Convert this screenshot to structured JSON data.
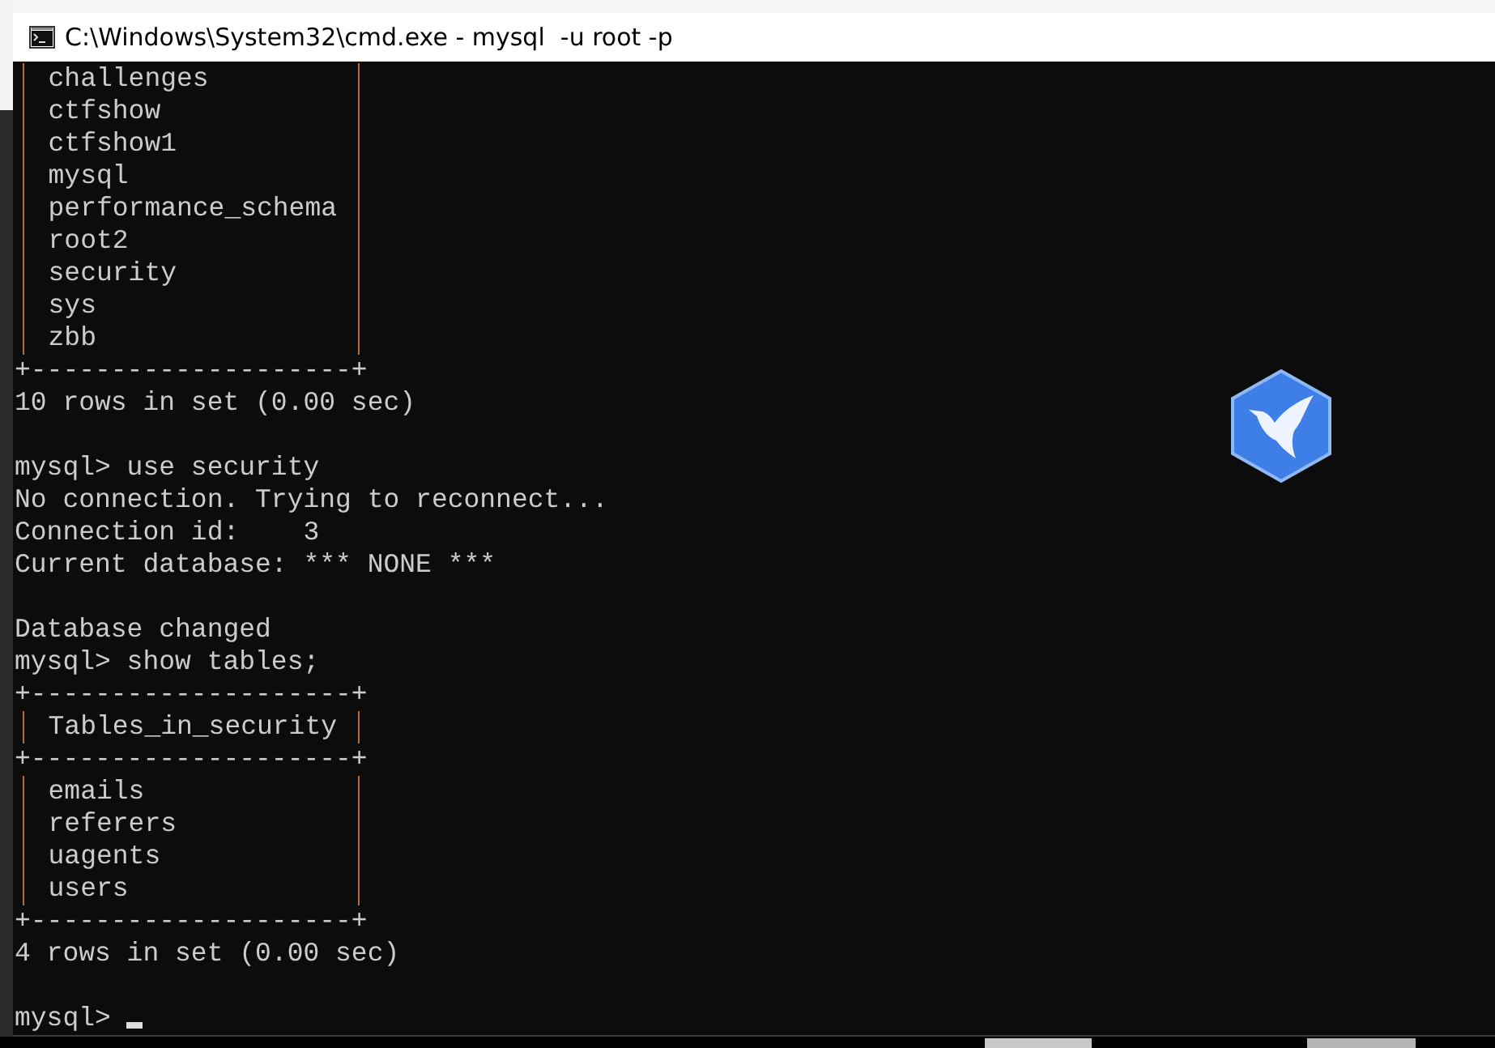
{
  "window": {
    "title": "C:\\Windows\\System32\\cmd.exe - mysql  -u root -p"
  },
  "console": {
    "lines": [
      {
        "kind": "row",
        "text": "challenges"
      },
      {
        "kind": "row",
        "text": "ctfshow"
      },
      {
        "kind": "row",
        "text": "ctfshow1"
      },
      {
        "kind": "row",
        "text": "mysql"
      },
      {
        "kind": "row",
        "text": "performance_schema"
      },
      {
        "kind": "row",
        "text": "root2"
      },
      {
        "kind": "row",
        "text": "security"
      },
      {
        "kind": "row",
        "text": "sys"
      },
      {
        "kind": "row",
        "text": "zbb"
      },
      {
        "kind": "border",
        "text": "+--------------------+"
      },
      {
        "kind": "text",
        "text": "10 rows in set (0.00 sec)"
      },
      {
        "kind": "blank"
      },
      {
        "kind": "text",
        "text": "mysql> use security"
      },
      {
        "kind": "text",
        "text": "No connection. Trying to reconnect..."
      },
      {
        "kind": "text",
        "text": "Connection id:    3"
      },
      {
        "kind": "text",
        "text": "Current database: *** NONE ***"
      },
      {
        "kind": "blank"
      },
      {
        "kind": "text",
        "text": "Database changed"
      },
      {
        "kind": "text",
        "text": "mysql> show tables;"
      },
      {
        "kind": "border",
        "text": "+--------------------+"
      },
      {
        "kind": "row",
        "text": "Tables_in_security"
      },
      {
        "kind": "border",
        "text": "+--------------------+"
      },
      {
        "kind": "row",
        "text": "emails"
      },
      {
        "kind": "row",
        "text": "referers"
      },
      {
        "kind": "row",
        "text": "uagents"
      },
      {
        "kind": "row",
        "text": "users"
      },
      {
        "kind": "border",
        "text": "+--------------------+"
      },
      {
        "kind": "text",
        "text": "4 rows in set (0.00 sec)"
      },
      {
        "kind": "blank"
      },
      {
        "kind": "prompt",
        "text": "mysql>"
      }
    ]
  }
}
